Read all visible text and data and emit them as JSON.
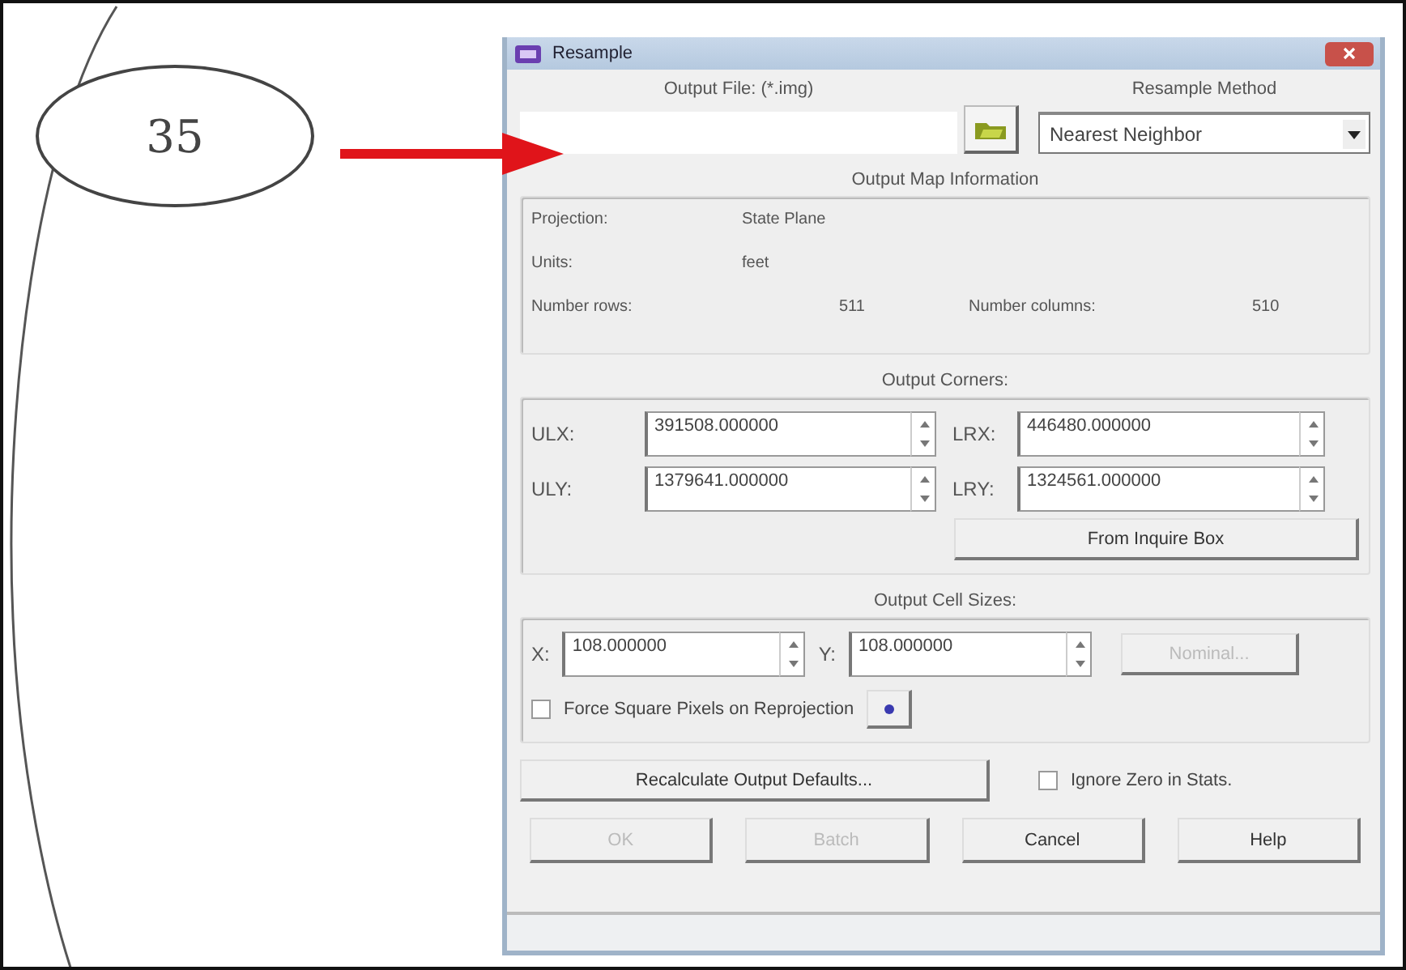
{
  "annotation": {
    "label": "35"
  },
  "window": {
    "title": "Resample"
  },
  "output_file": {
    "label": "Output File: (*.img)"
  },
  "resample_method": {
    "label": "Resample Method",
    "value": "Nearest Neighbor"
  },
  "map_info": {
    "title": "Output Map Information",
    "projection_label": "Projection:",
    "projection": "State Plane",
    "units_label": "Units:",
    "units": "feet",
    "rows_label": "Number rows:",
    "rows": "511",
    "columns_label": "Number columns:",
    "columns": "510"
  },
  "corners": {
    "title": "Output Corners:",
    "fields": [
      {
        "label": "ULX:",
        "value": "391508.000000"
      },
      {
        "label": "LRX:",
        "value": "446480.000000"
      },
      {
        "label": "ULY:",
        "value": "1379641.000000"
      },
      {
        "label": "LRY:",
        "value": "1324561.000000"
      }
    ],
    "button": {
      "label": "From Inquire Box",
      "disabled": false
    }
  },
  "cell_sizes": {
    "title": "Output Cell Sizes:",
    "fields": [
      {
        "label": "X:",
        "value": "108.000000"
      },
      {
        "label": "Y:",
        "value": "108.000000"
      }
    ],
    "button": {
      "label": "Nominal...",
      "disabled": true
    },
    "checkbox": {
      "label": "Force Square Pixels on Reprojection",
      "checked": false
    }
  },
  "recalc_button": {
    "label": "Recalculate Output Defaults...",
    "disabled": false
  },
  "ignore_zero": {
    "label": "Ignore Zero in Stats.",
    "checked": false
  },
  "buttons": [
    {
      "label": "OK",
      "disabled": true
    },
    {
      "label": "Batch",
      "disabled": true
    },
    {
      "label": "Cancel",
      "disabled": false
    },
    {
      "label": "Help",
      "disabled": false
    }
  ]
}
